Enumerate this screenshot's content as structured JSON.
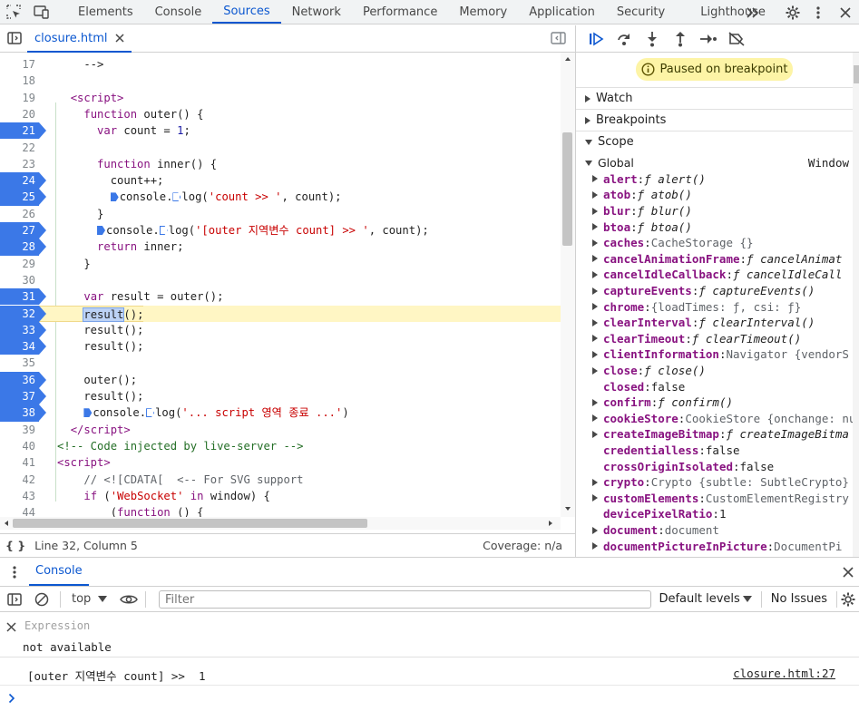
{
  "top_tabs": [
    "Elements",
    "Console",
    "Sources",
    "Network",
    "Performance",
    "Memory",
    "Application",
    "Security",
    "Lighthouse"
  ],
  "file_tab": "closure.html",
  "code_lines": [
    {
      "n": "17",
      "bp": false,
      "cur": false,
      "html": "    --&gt;"
    },
    {
      "n": "18",
      "bp": false,
      "cur": false,
      "html": ""
    },
    {
      "n": "19",
      "bp": false,
      "cur": false,
      "html": "  <span class=\"tag\">&lt;script&gt;</span>"
    },
    {
      "n": "20",
      "bp": false,
      "cur": false,
      "html": "    <span class=\"kw\">function</span> outer() {"
    },
    {
      "n": "21",
      "bp": true,
      "cur": false,
      "html": "      <span class=\"kw\">var</span> count = <span class=\"num\">1</span>;"
    },
    {
      "n": "22",
      "bp": false,
      "cur": false,
      "html": ""
    },
    {
      "n": "23",
      "bp": false,
      "cur": false,
      "html": "      <span class=\"kw\">function</span> inner() {"
    },
    {
      "n": "24",
      "bp": true,
      "cur": false,
      "html": "        count++;"
    },
    {
      "n": "25",
      "bp": true,
      "cur": false,
      "html": "        <span class=\"inbp\"></span>console.<span class=\"inbpo\"></span>log(<span class=\"str\">'count &gt;&gt; '</span>, count);"
    },
    {
      "n": "26",
      "bp": false,
      "cur": false,
      "html": "      }"
    },
    {
      "n": "27",
      "bp": true,
      "cur": false,
      "html": "      <span class=\"inbp\"></span>console.<span class=\"inbpo\"></span>log(<span class=\"str\">'[outer 지역변수 count] &gt;&gt; '</span>, count);"
    },
    {
      "n": "28",
      "bp": true,
      "cur": false,
      "html": "      <span class=\"kw\">return</span> inner;"
    },
    {
      "n": "29",
      "bp": false,
      "cur": false,
      "html": "    }"
    },
    {
      "n": "30",
      "bp": false,
      "cur": false,
      "html": ""
    },
    {
      "n": "31",
      "bp": true,
      "cur": false,
      "html": "    <span class=\"kw\">var</span> result = outer();"
    },
    {
      "n": "32",
      "bp": true,
      "cur": true,
      "html": "    <span class=\"hl\">result</span>();"
    },
    {
      "n": "33",
      "bp": true,
      "cur": false,
      "html": "    result();"
    },
    {
      "n": "34",
      "bp": true,
      "cur": false,
      "html": "    result();"
    },
    {
      "n": "35",
      "bp": false,
      "cur": false,
      "html": ""
    },
    {
      "n": "36",
      "bp": true,
      "cur": false,
      "html": "    outer();"
    },
    {
      "n": "37",
      "bp": true,
      "cur": false,
      "html": "    result();"
    },
    {
      "n": "38",
      "bp": true,
      "cur": false,
      "html": "    <span class=\"inbp\"></span>console.<span class=\"inbpo\"></span>log(<span class=\"str\">'... script 영역 종료 ...'</span>)"
    },
    {
      "n": "39",
      "bp": false,
      "cur": false,
      "html": "  <span class=\"tag\">&lt;/script&gt;</span>"
    },
    {
      "n": "40",
      "bp": false,
      "cur": false,
      "html": "<span class=\"cm\">&lt;!-- Code injected by live-server --&gt;</span>"
    },
    {
      "n": "41",
      "bp": false,
      "cur": false,
      "html": "<span class=\"tag\">&lt;script&gt;</span>"
    },
    {
      "n": "42",
      "bp": false,
      "cur": false,
      "html": "    <span class=\"cm2\">// &lt;![CDATA[  &lt;-- For SVG support</span>"
    },
    {
      "n": "43",
      "bp": false,
      "cur": false,
      "html": "    <span class=\"kw\">if</span> (<span class=\"str\">'WebSocket'</span> <span class=\"kw\">in</span> window) {"
    },
    {
      "n": "44",
      "bp": false,
      "cur": false,
      "html": "        (<span class=\"kw\">function</span> () {"
    }
  ],
  "status": {
    "position": "Line 32, Column 5",
    "coverage": "Coverage: n/a"
  },
  "paused_label": "Paused on breakpoint",
  "sections": {
    "watch": "Watch",
    "breakpoints": "Breakpoints",
    "scope": "Scope"
  },
  "scope_header": {
    "label": "Global",
    "value": "Window"
  },
  "scope_items": [
    {
      "name": "alert",
      "val": "ƒ alert()",
      "kind": "f",
      "exp": true
    },
    {
      "name": "atob",
      "val": "ƒ atob()",
      "kind": "f",
      "exp": true
    },
    {
      "name": "blur",
      "val": "ƒ blur()",
      "kind": "f",
      "exp": true
    },
    {
      "name": "btoa",
      "val": "ƒ btoa()",
      "kind": "f",
      "exp": true
    },
    {
      "name": "caches",
      "val": "CacheStorage {}",
      "kind": "o",
      "exp": true
    },
    {
      "name": "cancelAnimationFrame",
      "val": "ƒ cancelAnimat",
      "kind": "f",
      "exp": true
    },
    {
      "name": "cancelIdleCallback",
      "val": "ƒ cancelIdleCall",
      "kind": "f",
      "exp": true
    },
    {
      "name": "captureEvents",
      "val": "ƒ captureEvents()",
      "kind": "f",
      "exp": true
    },
    {
      "name": "chrome",
      "val": "{loadTimes: ƒ, csi: ƒ}",
      "kind": "o",
      "exp": true
    },
    {
      "name": "clearInterval",
      "val": "ƒ clearInterval()",
      "kind": "f",
      "exp": true
    },
    {
      "name": "clearTimeout",
      "val": "ƒ clearTimeout()",
      "kind": "f",
      "exp": true
    },
    {
      "name": "clientInformation",
      "val": "Navigator {vendorS",
      "kind": "o",
      "exp": true
    },
    {
      "name": "close",
      "val": "ƒ close()",
      "kind": "f",
      "exp": true
    },
    {
      "name": "closed",
      "val": "false",
      "kind": "v",
      "exp": false
    },
    {
      "name": "confirm",
      "val": "ƒ confirm()",
      "kind": "f",
      "exp": true
    },
    {
      "name": "cookieStore",
      "val": "CookieStore {onchange: nu",
      "kind": "o",
      "exp": true
    },
    {
      "name": "createImageBitmap",
      "val": "ƒ createImageBitma",
      "kind": "f",
      "exp": true
    },
    {
      "name": "credentialless",
      "val": "false",
      "kind": "v",
      "exp": false
    },
    {
      "name": "crossOriginIsolated",
      "val": "false",
      "kind": "v",
      "exp": false
    },
    {
      "name": "crypto",
      "val": "Crypto {subtle: SubtleCrypto}",
      "kind": "o",
      "exp": true
    },
    {
      "name": "customElements",
      "val": "CustomElementRegistry",
      "kind": "o",
      "exp": true
    },
    {
      "name": "devicePixelRatio",
      "val": "1",
      "kind": "v",
      "exp": false
    },
    {
      "name": "document",
      "val": "document",
      "kind": "o",
      "exp": true
    },
    {
      "name": "documentPictureInPicture",
      "val": "DocumentPi",
      "kind": "o",
      "exp": true
    }
  ],
  "drawer": {
    "tab": "Console",
    "context": "top",
    "filter_placeholder": "Filter",
    "levels": "Default levels",
    "issues": "No Issues",
    "expression_placeholder": "Expression",
    "expression_value": "not available",
    "log_message": "[outer 지역변수 count] >>  1",
    "log_source": "closure.html:27"
  }
}
